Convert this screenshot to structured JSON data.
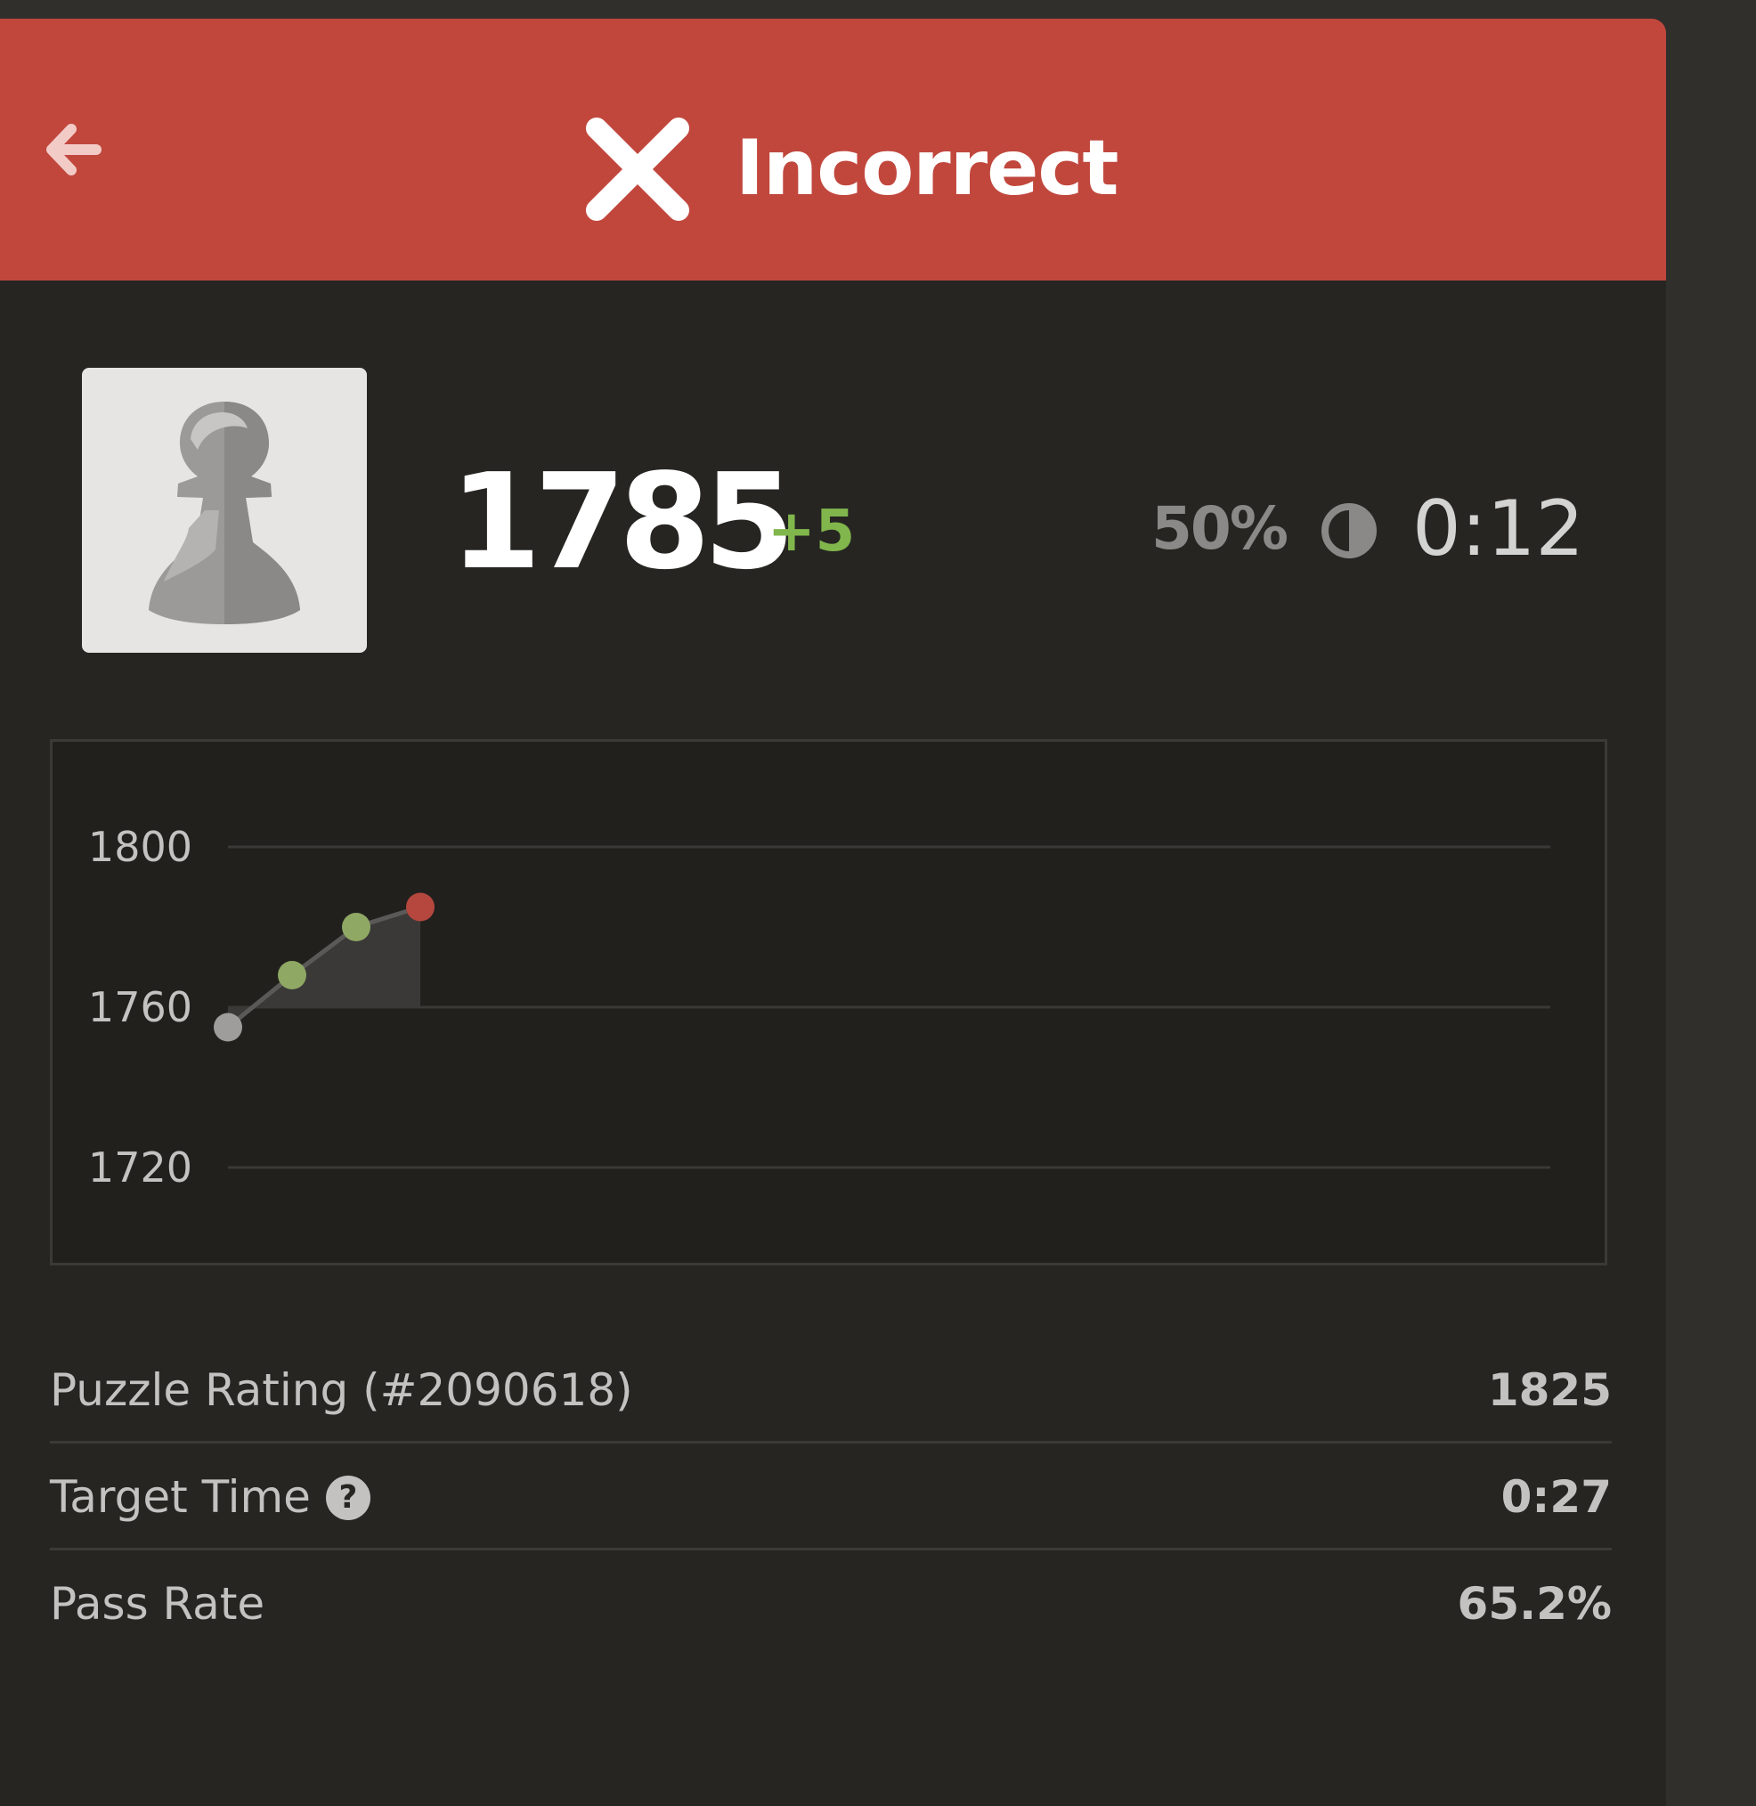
{
  "header": {
    "status_text": "Incorrect",
    "back_icon": "arrow-left-icon",
    "status_icon": "x-icon",
    "color": "#c1473d"
  },
  "summary": {
    "piece_icon": "pawn-icon",
    "rating": "1785",
    "rating_change": "+5",
    "accuracy": "50%",
    "clock_icon": "clock-icon",
    "time": "0:12",
    "change_color": "#81b64c"
  },
  "chart_data": {
    "type": "line",
    "ylim": [
      1720,
      1800
    ],
    "y_ticks": [
      "1800",
      "1760",
      "1720"
    ],
    "points": [
      {
        "x": 0,
        "y": 1755,
        "color": "#9e9d9b"
      },
      {
        "x": 1,
        "y": 1768,
        "color": "#8fa864"
      },
      {
        "x": 2,
        "y": 1780,
        "color": "#8fa864"
      },
      {
        "x": 3,
        "y": 1785,
        "color": "#b5473f"
      }
    ],
    "x_max": 20,
    "grid": true
  },
  "stats": {
    "puzzle_rating_label": "Puzzle Rating (#2090618)",
    "puzzle_rating_value": "1825",
    "target_time_label": "Target Time",
    "target_time_value": "0:27",
    "help_icon": "question-icon",
    "help_glyph": "?",
    "pass_rate_label": "Pass Rate",
    "pass_rate_value": "65.2%"
  }
}
